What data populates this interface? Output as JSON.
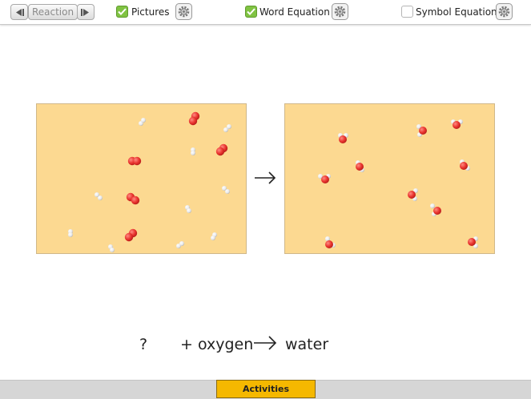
{
  "toolbar": {
    "reaction_label": "Reaction",
    "pictures": {
      "label": "Pictures",
      "checked": true
    },
    "word_equation": {
      "label": "Word Equation",
      "checked": true
    },
    "symbol_equation": {
      "label": "Symbol Equation",
      "checked": false
    }
  },
  "equation": {
    "unknown": "?",
    "plus_oxygen": "+ oxygen",
    "product": "water"
  },
  "footer": {
    "activities_label": "Activities"
  },
  "colors": {
    "panel_bg": "#fcd991",
    "oxygen_atom": "#e8322d",
    "hydrogen_atom": "#eeeeee",
    "checkbox_on": "#80c342",
    "activities_button": "#f5b800"
  },
  "icons": [
    "step-back-icon",
    "step-forward-icon",
    "checkmark-icon",
    "gear-icon",
    "reaction-arrow-icon"
  ]
}
